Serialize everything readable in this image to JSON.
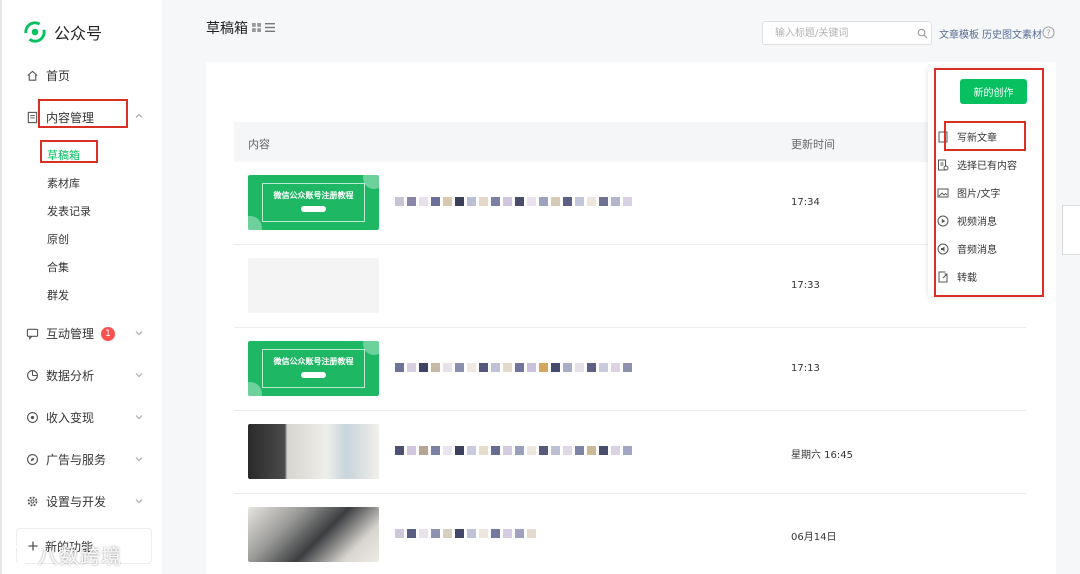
{
  "app": {
    "name": "公众号"
  },
  "sidebar": {
    "home": "首页",
    "content_mgmt": "内容管理",
    "sub_items": [
      "草稿箱",
      "素材库",
      "发表记录",
      "原创",
      "合集",
      "群发"
    ],
    "interaction": "互动管理",
    "interaction_badge": "1",
    "analytics": "数据分析",
    "income": "收入变现",
    "ads": "广告与服务",
    "settings": "设置与开发",
    "new_features": "新的功能"
  },
  "header": {
    "title": "草稿箱",
    "search_placeholder": "输入标题/关键词",
    "link_templates": "文章模板",
    "link_history": "历史图文素材"
  },
  "table": {
    "col_content": "内容",
    "col_time": "更新时间",
    "thumb_title": "微信公众账号注册教程",
    "rows": [
      {
        "time": "17:34"
      },
      {
        "time": "17:33"
      },
      {
        "time": "17:13"
      },
      {
        "time": "星期六 16:45"
      },
      {
        "time": "06月14日"
      }
    ]
  },
  "create_menu": {
    "button": "新的创作",
    "items": [
      "写新文章",
      "选择已有内容",
      "图片/文字",
      "视频消息",
      "音频消息",
      "转载"
    ]
  },
  "watermark": "八数跨境",
  "colors": {
    "accent": "#07c160",
    "highlight": "#d93025",
    "link": "#576b95"
  }
}
